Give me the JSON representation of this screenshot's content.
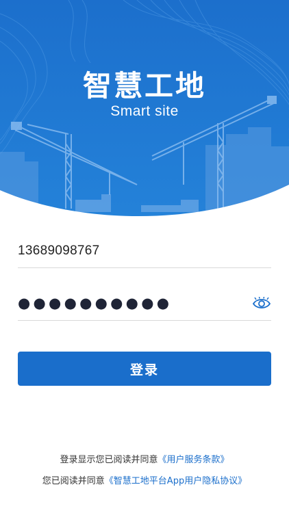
{
  "brand": {
    "primary_color": "#1a6ecb",
    "hero_color": "#1b74d0"
  },
  "hero": {
    "title": "智慧工地",
    "subtitle": "Smart site"
  },
  "login_form": {
    "phone_value": "13689098767",
    "password_mask": "●●●●●●●●●●",
    "password_toggle_icon": "eye-icon",
    "submit_label": "登录"
  },
  "agreement": {
    "line1_prefix": "登录显示您已阅读并同意",
    "line1_link": "《用户服务条款》",
    "line2_prefix": "您已阅读并同意",
    "line2_link": "《智慧工地平台App用户隐私协议》"
  }
}
